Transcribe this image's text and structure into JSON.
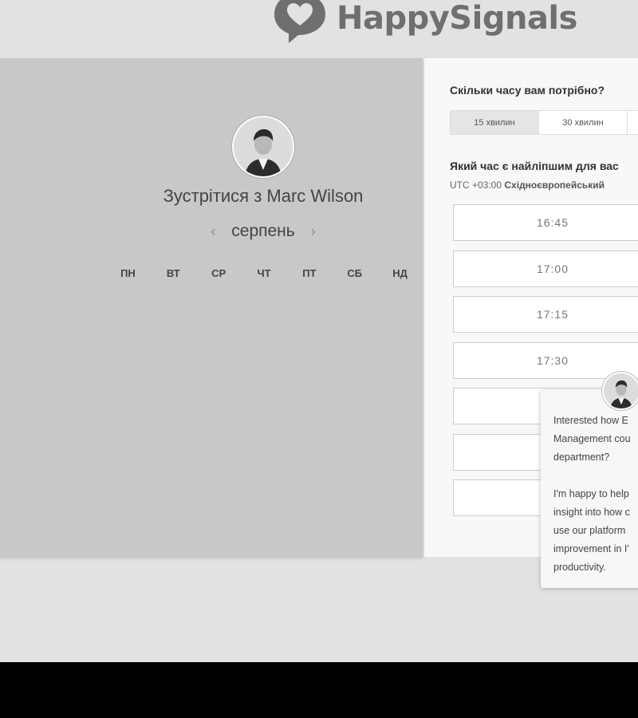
{
  "header": {
    "brand": "HappySignals",
    "logo_icon": "heart-speech-bubble-icon"
  },
  "calendar": {
    "title": "Зустрітися з Marc Wilson",
    "month": "серпень",
    "prev_icon": "‹",
    "next_icon": "›",
    "weekdays": [
      "ПН",
      "ВТ",
      "СР",
      "ЧТ",
      "ПТ",
      "СБ",
      "НД"
    ]
  },
  "timepicker": {
    "duration_question": "Скільки часу вам потрібно?",
    "durations": [
      "15 хвилин",
      "30 хвилин",
      ""
    ],
    "selected_duration_index": 0,
    "time_question": "Який час є найліпшим для вас",
    "timezone_offset": "UTC +03:00",
    "timezone_name": "Східноєвропейський",
    "slots": [
      "16:45",
      "17:00",
      "17:15",
      "17:30",
      "",
      "",
      "",
      ""
    ]
  },
  "chat": {
    "message": "Interested how E\nManagement cou\ndepartment?\n\nI'm happy to help\ninsight into how c\nuse our platform\nimprovement in I'\nproductivity."
  },
  "colors": {
    "page_bg": "#e2e2e2",
    "left_panel_bg": "#c8c8c8",
    "right_panel_bg": "#f8f8f8",
    "logo_gray": "#6f6f6f"
  }
}
